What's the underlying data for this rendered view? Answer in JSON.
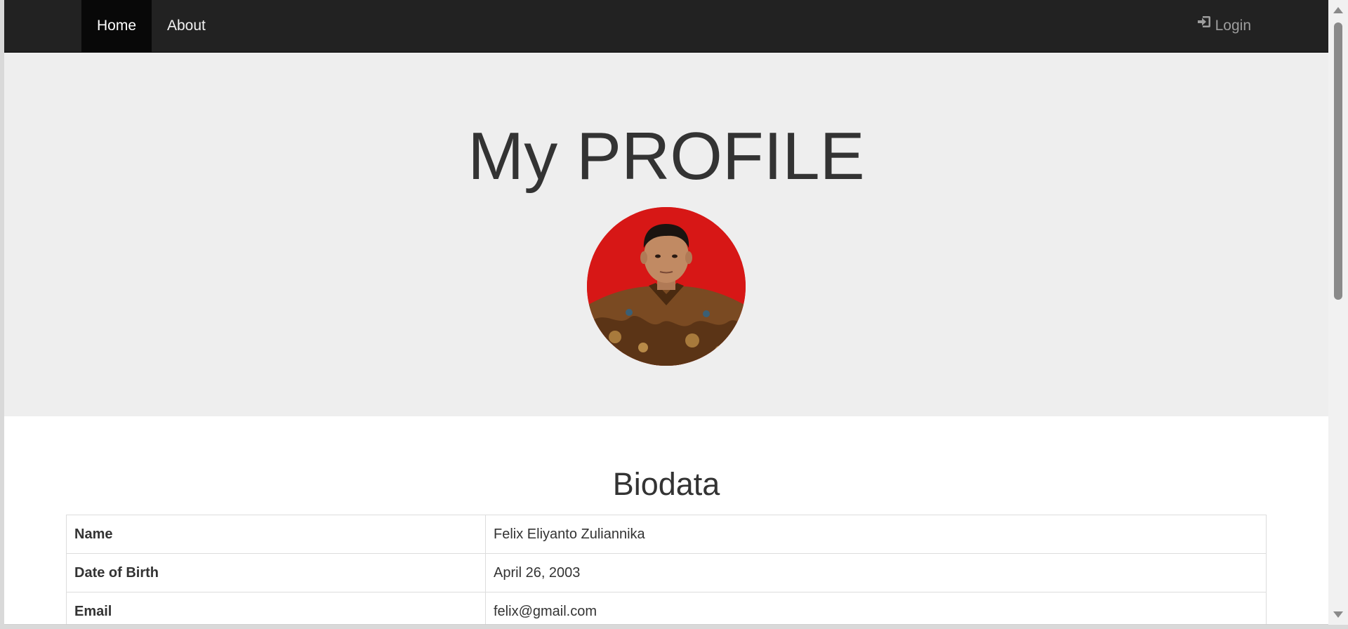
{
  "nav": {
    "items": [
      {
        "label": "Home"
      },
      {
        "label": "About"
      }
    ],
    "login_label": "Login",
    "login_icon": "sign-in-icon"
  },
  "hero": {
    "title": "My PROFILE",
    "avatar_bg_color": "#d71716"
  },
  "biodata": {
    "title": "Biodata",
    "rows": [
      {
        "key": "Name",
        "value": "Felix Eliyanto Zuliannika"
      },
      {
        "key": "Date of Birth",
        "value": "April 26, 2003"
      },
      {
        "key": "Email",
        "value": "felix@gmail.com"
      }
    ]
  },
  "colors": {
    "navbar_bg": "#222222",
    "navbar_active": "#080808",
    "jumbotron_bg": "#eeeeee",
    "text": "#333333",
    "login_text": "#9d9d9d"
  }
}
